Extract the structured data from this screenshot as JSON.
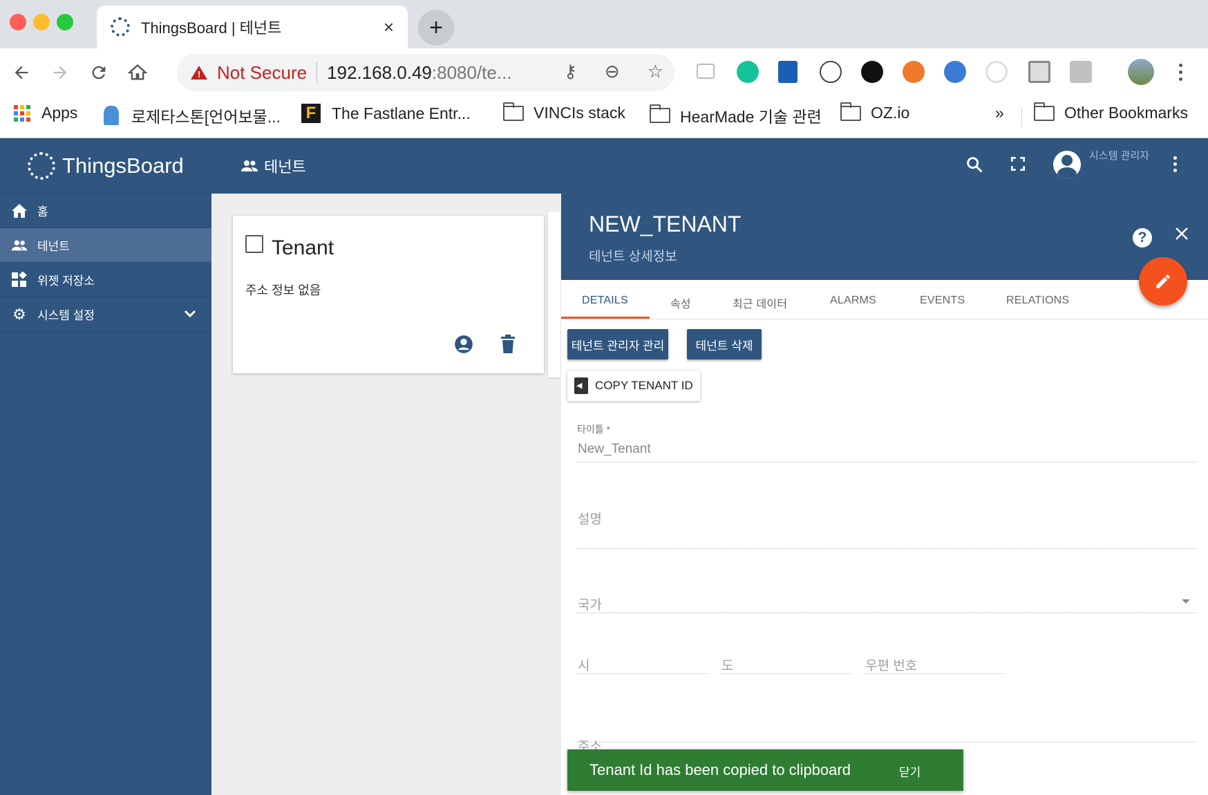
{
  "browser": {
    "tab_title": "ThingsBoard | 테넌트",
    "tab_close": "×",
    "new_tab": "+",
    "security_label": "Not Secure",
    "url_host": "192.168.0.49",
    "url_rest": ":8080/te...",
    "bookmarks": [
      {
        "label": "Apps",
        "icon": "apps-grid-icon"
      },
      {
        "label": "로제타스톤[언어보물...",
        "icon": "rosetta-icon"
      },
      {
        "label": "The Fastlane Entr...",
        "icon": "fastlane-icon"
      },
      {
        "label": "VINCIs stack",
        "icon": "folder-icon"
      },
      {
        "label": "HearMade 기술 관련",
        "icon": "folder-icon"
      },
      {
        "label": "OZ.io",
        "icon": "folder-icon"
      }
    ],
    "bookmarks_overflow": "»",
    "other_bookmarks": "Other Bookmarks"
  },
  "app": {
    "brand": "ThingsBoard",
    "page_title": "테넌트",
    "user_name": "시스템 관리자",
    "sidebar": [
      {
        "label": "홈",
        "icon": "home-icon"
      },
      {
        "label": "테넌트",
        "icon": "people-icon",
        "active": true
      },
      {
        "label": "위젯 저장소",
        "icon": "widgets-icon"
      },
      {
        "label": "시스템 설정",
        "icon": "settings-icon",
        "expandable": true
      }
    ],
    "card": {
      "title": "Tenant",
      "address": "주소 정보 없음"
    }
  },
  "detail": {
    "title": "NEW_TENANT",
    "subtitle": "테넌트 상세정보",
    "tabs": [
      "DETAILS",
      "속성",
      "최근 데이터",
      "ALARMS",
      "EVENTS",
      "RELATIONS"
    ],
    "active_tab": "DETAILS",
    "btn_manage_admins": "테넌트 관리자 관리",
    "btn_delete": "테넌트 삭제",
    "btn_copy_id": "COPY TENANT ID",
    "fields": {
      "title_label": "타이틀 *",
      "title_value": "New_Tenant",
      "description": "설명",
      "country": "국가",
      "city": "시",
      "state": "도",
      "zip": "우편 번호",
      "address": "주소"
    }
  },
  "toast": {
    "message": "Tenant Id has been copied to clipboard",
    "action": "닫기"
  },
  "colors": {
    "primary": "#305680",
    "accent": "#f4511e",
    "toast": "#2e7d32",
    "warning": "#c5221f"
  }
}
